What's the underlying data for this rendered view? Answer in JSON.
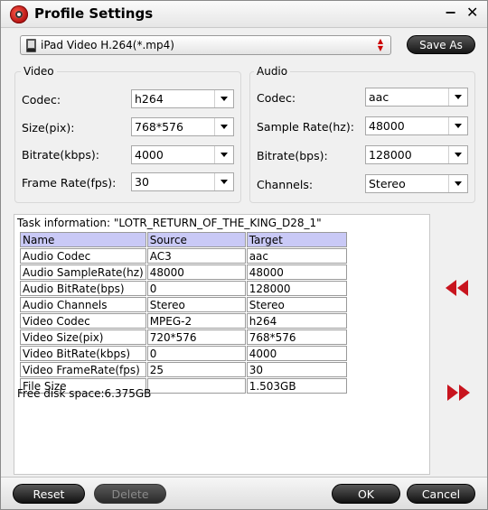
{
  "window": {
    "title": "Profile Settings",
    "minimize_label": "−",
    "close_label": "✕"
  },
  "profile": {
    "selected": "iPad Video H.264(*.mp4)",
    "save_as_label": "Save As"
  },
  "video": {
    "group_title": "Video",
    "codec_label": "Codec:",
    "codec_value": "h264",
    "size_label": "Size(pix):",
    "size_value": "768*576",
    "bitrate_label": "Bitrate(kbps):",
    "bitrate_value": "4000",
    "framerate_label": "Frame Rate(fps):",
    "framerate_value": "30"
  },
  "audio": {
    "group_title": "Audio",
    "codec_label": "Codec:",
    "codec_value": "aac",
    "samplerate_label": "Sample Rate(hz):",
    "samplerate_value": "48000",
    "bitrate_label": "Bitrate(bps):",
    "bitrate_value": "128000",
    "channels_label": "Channels:",
    "channels_value": "Stereo"
  },
  "task": {
    "title": "Task information: \"LOTR_RETURN_OF_THE_KING_D28_1\"",
    "headers": [
      "Name",
      "Source",
      "Target"
    ],
    "rows": [
      [
        "Audio Codec",
        "AC3",
        "aac"
      ],
      [
        "Audio SampleRate(hz)",
        "48000",
        "48000"
      ],
      [
        "Audio BitRate(bps)",
        "0",
        "128000"
      ],
      [
        "Audio Channels",
        "Stereo",
        "Stereo"
      ],
      [
        "Video Codec",
        "MPEG-2",
        "h264"
      ],
      [
        "Video Size(pix)",
        "720*576",
        "768*576"
      ],
      [
        "Video BitRate(kbps)",
        "0",
        "4000"
      ],
      [
        "Video FrameRate(fps)",
        "25",
        "30"
      ],
      [
        "File Size",
        "",
        "1.503GB"
      ]
    ],
    "free_space": "Free disk space:6.375GB"
  },
  "buttons": {
    "reset": "Reset",
    "delete": "Delete",
    "ok": "OK",
    "cancel": "Cancel"
  },
  "colors": {
    "accent_red": "#c8141e",
    "header_row": "#c9c9f6",
    "button_dark": "#1a1a1a"
  },
  "icons": {
    "app": "app-logo-icon",
    "profile": "ipad-device-icon",
    "prev": "double-left-arrow-icon",
    "next": "double-right-arrow-icon"
  }
}
